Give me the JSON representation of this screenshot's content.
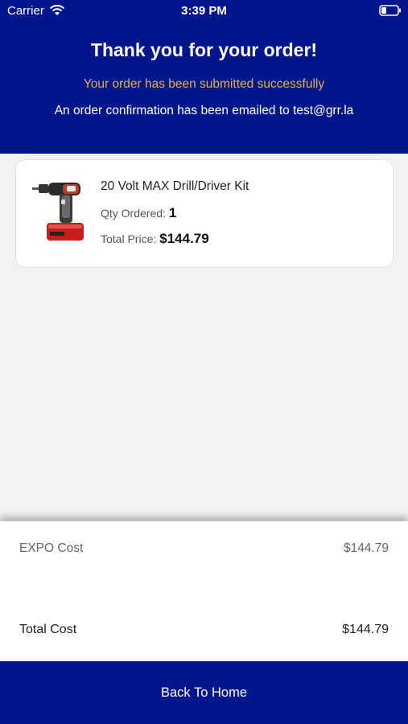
{
  "status_bar": {
    "carrier": "Carrier",
    "time": "3:39 PM",
    "icons": [
      "wifi-icon",
      "battery-icon"
    ]
  },
  "header": {
    "title": "Thank you for your order!",
    "success_message": "Your order has been submitted successfully",
    "email_message": "An order confirmation has been emailed to test@grr.la"
  },
  "order_item": {
    "name": "20 Volt MAX Drill/Driver Kit",
    "qty_label": "Qty Ordered:",
    "qty_value": "1",
    "price_label": "Total Price:",
    "price_value": "$144.79"
  },
  "summary": {
    "expo_label": "EXPO Cost",
    "expo_value": "$144.79",
    "total_label": "Total Cost",
    "total_value": "$144.79"
  },
  "footer": {
    "button_label": "Back To Home"
  },
  "colors": {
    "primary": "#02168c",
    "success_text": "#e0b24c",
    "background": "#f2f2f2"
  }
}
